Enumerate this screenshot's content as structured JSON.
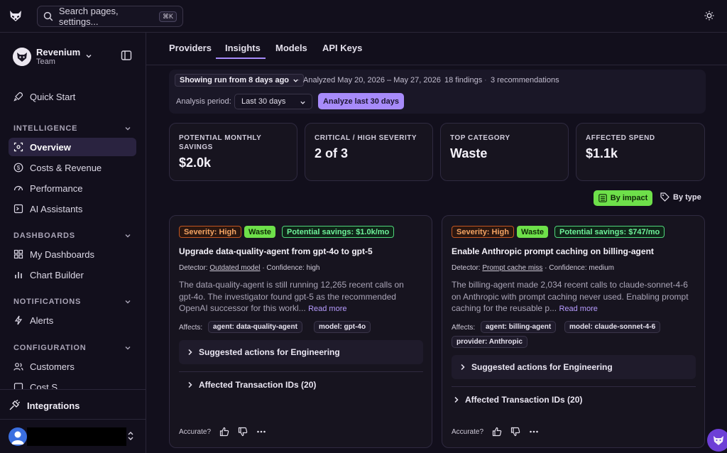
{
  "topbar": {
    "search_placeholder": "Search pages, settings...",
    "search_shortcut": "⌘K"
  },
  "sidebar": {
    "team_name": "Revenium",
    "team_role": "Team",
    "quick_start": "Quick Start",
    "sections": [
      {
        "label": "INTELLIGENCE",
        "items": [
          "Overview",
          "Costs & Revenue",
          "Performance",
          "AI Assistants"
        ]
      },
      {
        "label": "DASHBOARDS",
        "items": [
          "My Dashboards",
          "Chart Builder"
        ]
      },
      {
        "label": "NOTIFICATIONS",
        "items": [
          "Alerts"
        ]
      },
      {
        "label": "CONFIGURATION",
        "items": [
          "Customers",
          "Cost S..."
        ]
      }
    ],
    "integrations": "Integrations"
  },
  "tabs": [
    "Providers",
    "Insights",
    "Models",
    "API Keys"
  ],
  "active_tab": "Insights",
  "run": {
    "selector": "Showing run from 8 days ago",
    "analyzed": "Analyzed May 20, 2026 – May 27, 2026",
    "findings": "18 findings",
    "recommendations": "3 recommendations",
    "period_label": "Analysis period:",
    "period_value": "Last 30 days",
    "analyze_button": "Analyze last 30 days"
  },
  "stats": [
    {
      "label": "POTENTIAL MONTHLY SAVINGS",
      "value": "$2.0k"
    },
    {
      "label": "CRITICAL / HIGH SEVERITY",
      "value": "2 of 3"
    },
    {
      "label": "TOP CATEGORY",
      "value": "Waste"
    },
    {
      "label": "AFFECTED SPEND",
      "value": "$1.1k"
    }
  ],
  "sort": {
    "by_impact": "By impact",
    "by_type": "By type"
  },
  "cards": [
    {
      "severity": "Severity: High",
      "category": "Waste",
      "savings": "Potential savings: $1.0k/mo",
      "title": "Upgrade data-quality-agent from gpt-4o to gpt-5",
      "detector_prefix": "Detector:",
      "detector": "Outdated model",
      "confidence": "· Confidence: high",
      "description": "The data-quality-agent is still running 12,265 recent calls on gpt-4o. The investigator found gpt-5 as the recommended OpenAI successor for this workl...",
      "read_more": "Read more",
      "affects_label": "Affects:",
      "chips": [
        "agent: data-quality-agent",
        "model: gpt-4o"
      ],
      "actions": "Suggested actions for Engineering",
      "transactions": "Affected Transaction IDs (20)",
      "accurate": "Accurate?"
    },
    {
      "severity": "Severity: High",
      "category": "Waste",
      "savings": "Potential savings: $747/mo",
      "title": "Enable Anthropic prompt caching on billing-agent",
      "detector_prefix": "Detector:",
      "detector": "Prompt cache miss",
      "confidence": "· Confidence: medium",
      "description": "The billing-agent made 2,034 recent calls to claude-sonnet-4-6 on Anthropic with prompt caching never used. Enabling prompt caching for the reusable p...",
      "read_more": "Read more",
      "affects_label": "Affects:",
      "chips": [
        "agent: billing-agent",
        "model: claude-sonnet-4-6",
        "provider: Anthropic"
      ],
      "actions": "Suggested actions for Engineering",
      "transactions": "Affected Transaction IDs (20)",
      "accurate": "Accurate?"
    }
  ],
  "colors": {
    "accent": "#a78bfa",
    "green": "#6ee04a",
    "severity": "#c2561f",
    "savings": "#4fd67a"
  }
}
